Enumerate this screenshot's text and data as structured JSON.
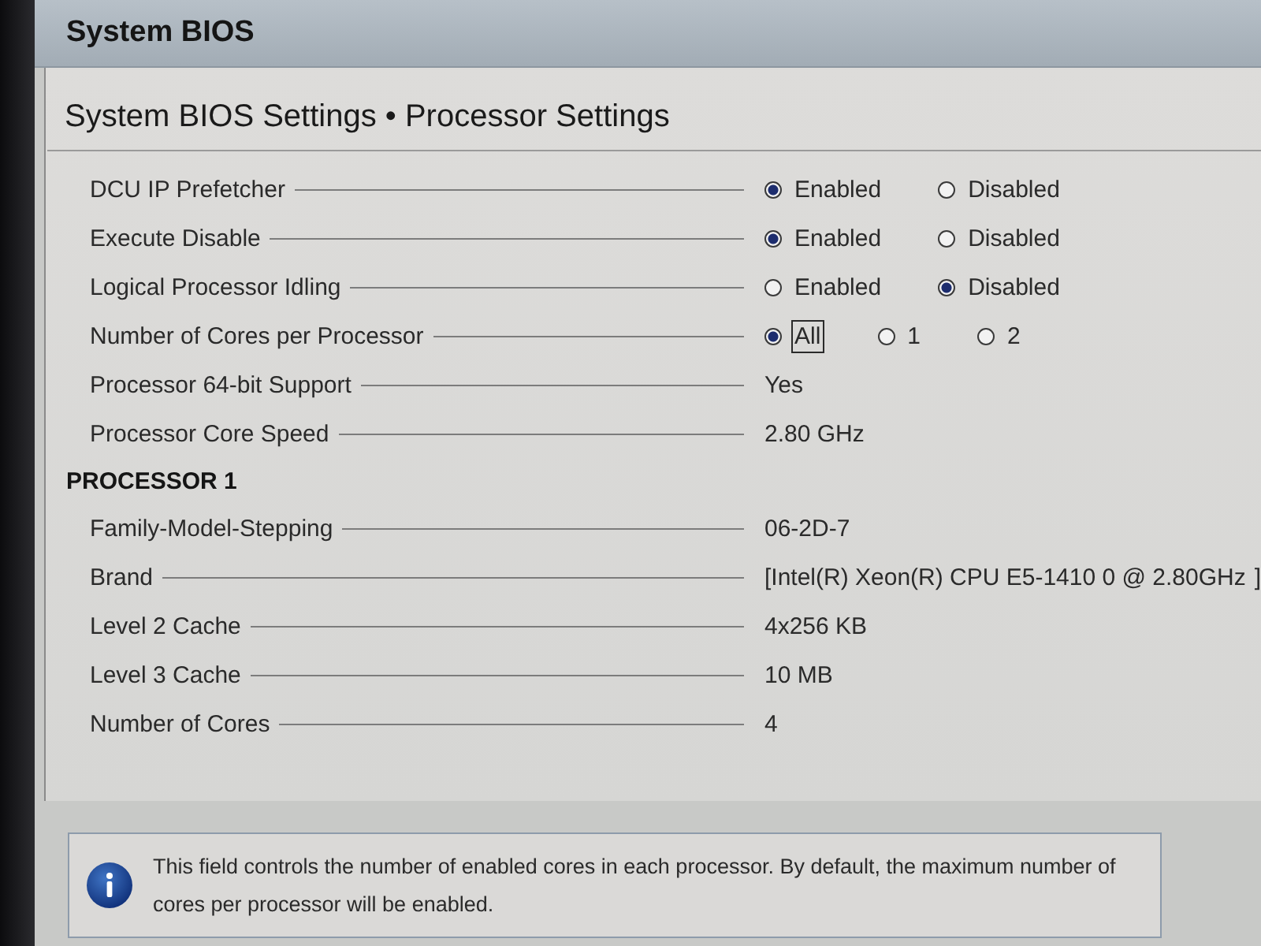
{
  "header": {
    "title": "System BIOS"
  },
  "page": {
    "title": "System BIOS Settings • Processor Settings"
  },
  "settings": [
    {
      "kind": "radio",
      "label": "DCU IP Prefetcher",
      "options": [
        {
          "label": "Enabled",
          "selected": true,
          "focused": false
        },
        {
          "label": "Disabled",
          "selected": false,
          "focused": false
        }
      ]
    },
    {
      "kind": "radio",
      "label": "Execute Disable",
      "options": [
        {
          "label": "Enabled",
          "selected": true,
          "focused": false
        },
        {
          "label": "Disabled",
          "selected": false,
          "focused": false
        }
      ]
    },
    {
      "kind": "radio",
      "label": "Logical Processor Idling",
      "options": [
        {
          "label": "Enabled",
          "selected": false,
          "focused": false
        },
        {
          "label": "Disabled",
          "selected": true,
          "focused": false
        }
      ]
    },
    {
      "kind": "radio",
      "label": "Number of Cores per Processor",
      "options": [
        {
          "label": "All",
          "selected": true,
          "focused": true
        },
        {
          "label": "1",
          "selected": false,
          "focused": false
        },
        {
          "label": "2",
          "selected": false,
          "focused": false
        }
      ]
    },
    {
      "kind": "value",
      "label": "Processor 64-bit Support",
      "value": "Yes"
    },
    {
      "kind": "value",
      "label": "Processor Core Speed",
      "value": "2.80 GHz"
    }
  ],
  "sections": [
    {
      "title": "PROCESSOR 1",
      "rows": [
        {
          "kind": "value",
          "label": "Family-Model-Stepping",
          "value": "06-2D-7"
        },
        {
          "kind": "value",
          "label": "Brand",
          "value": "[Intel(R) Xeon(R) CPU E5-1410 0 @ 2.80GHz",
          "value_end": "]"
        },
        {
          "kind": "value",
          "label": "Level 2 Cache",
          "value": "4x256 KB"
        },
        {
          "kind": "value",
          "label": "Level 3 Cache",
          "value": "10 MB"
        },
        {
          "kind": "value",
          "label": "Number of Cores",
          "value": "4"
        }
      ]
    }
  ],
  "help": {
    "text": "This field controls the number of enabled cores in each processor. By default, the maximum number of cores per processor will be enabled."
  }
}
